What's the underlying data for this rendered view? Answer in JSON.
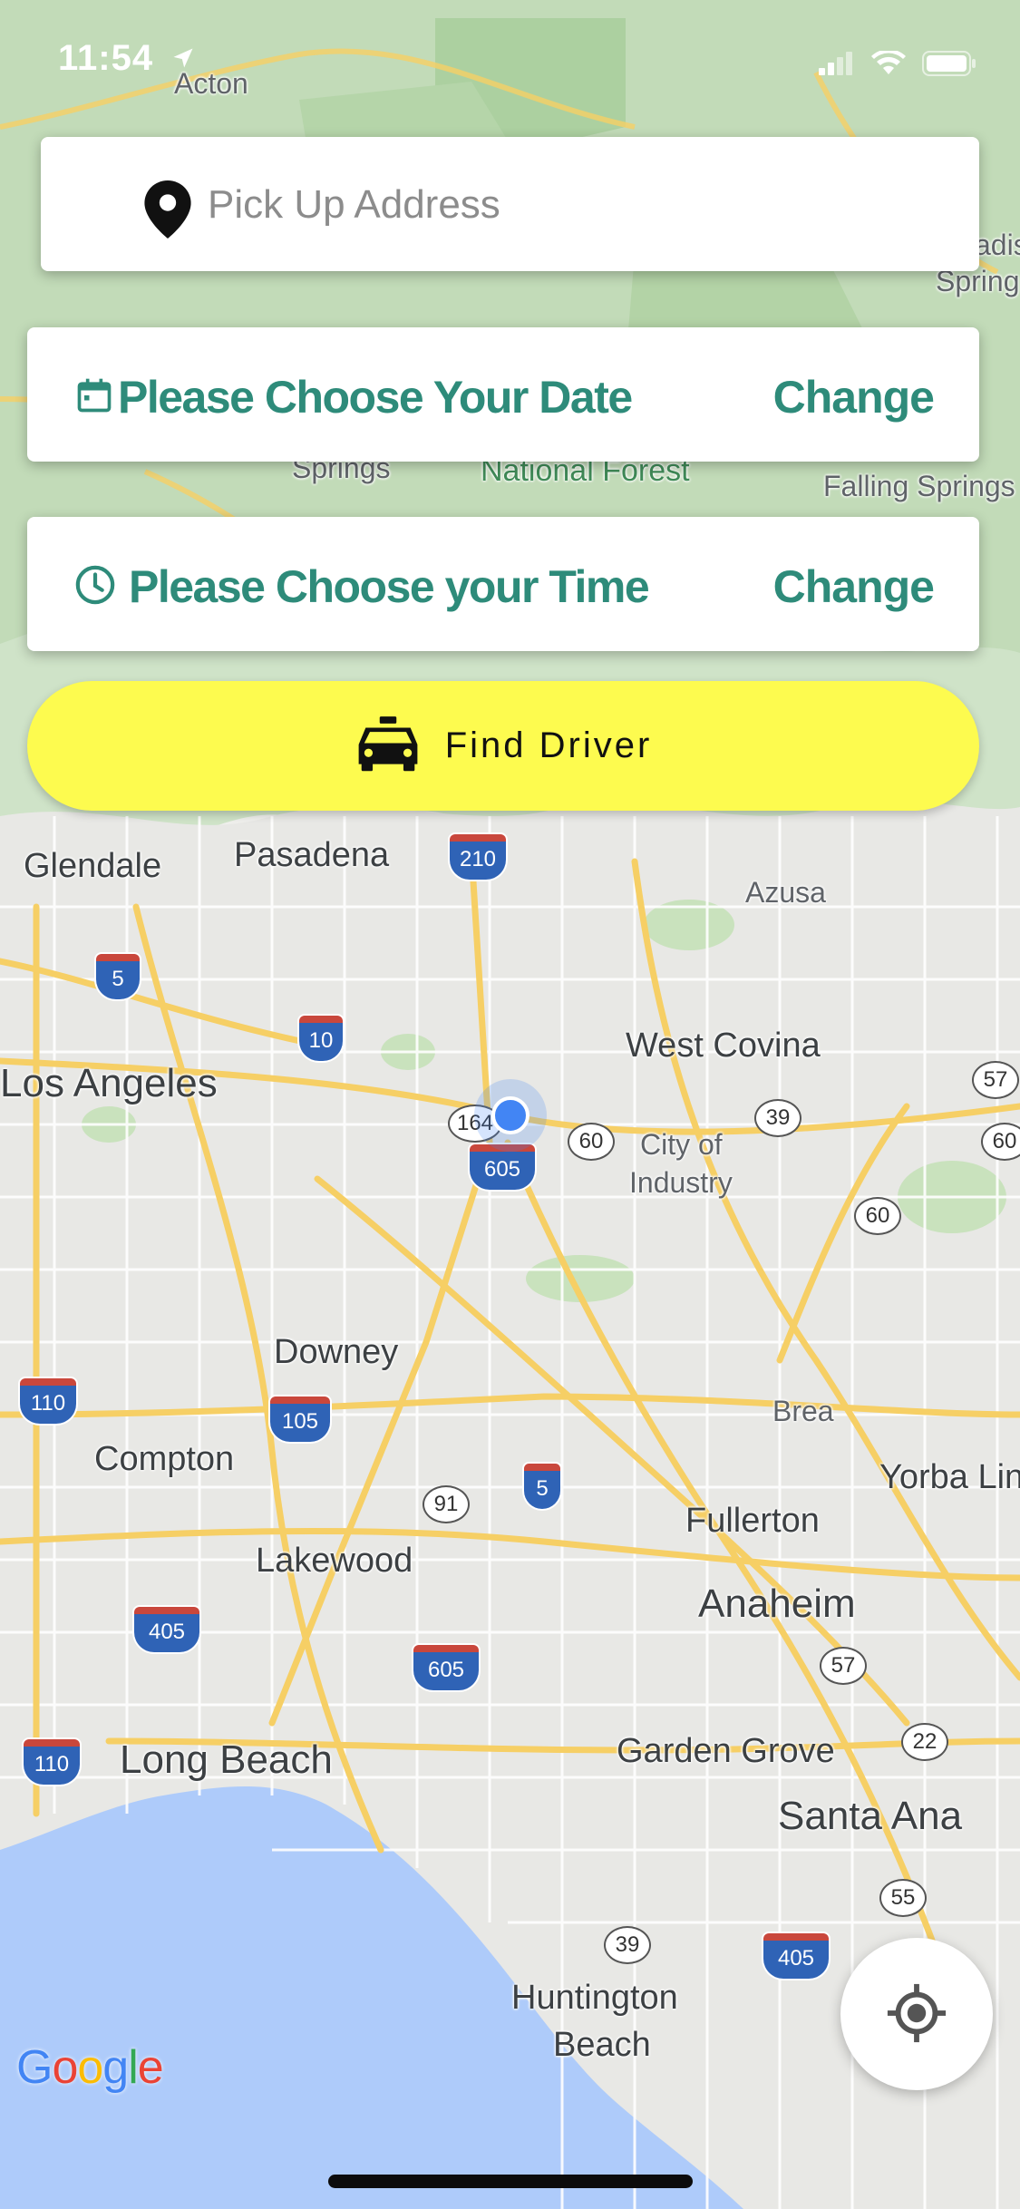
{
  "status_bar": {
    "time": "11:54"
  },
  "pickup": {
    "placeholder": "Pick Up Address",
    "icon": "map-pin-icon"
  },
  "date_row": {
    "label": "Please Choose Your Date",
    "change_label": "Change",
    "icon": "calendar-icon"
  },
  "time_row": {
    "label": "Please Choose your Time",
    "change_label": "Change",
    "icon": "clock-icon"
  },
  "find_driver": {
    "label": "Find Driver",
    "icon": "taxi-icon",
    "color": "#fdfb4f"
  },
  "accent_color": "#2e8b7a",
  "map": {
    "attribution": "Google",
    "places": [
      "Acton",
      "National Forest",
      "Springs",
      "Falling Springs",
      "Glendale",
      "Pasadena",
      "Azusa",
      "Los Angeles",
      "West Covina",
      "City of",
      "Industry",
      "Downey",
      "Brea",
      "Compton",
      "Yorba Lin",
      "Fullerton",
      "Lakewood",
      "Anaheim",
      "Long Beach",
      "Garden Grove",
      "Santa Ana",
      "Huntington",
      "Beach",
      "adis",
      "Spring"
    ],
    "highways": {
      "i210": "210",
      "i5a": "5",
      "i10": "10",
      "r164": "164",
      "i605a": "605",
      "r60a": "60",
      "r39a": "39",
      "r57a": "57",
      "r60b": "60",
      "r60c": "60",
      "i110a": "110",
      "i105": "105",
      "r91": "91",
      "i5b": "5",
      "i405a": "405",
      "i605b": "605",
      "r57b": "57",
      "i110b": "110",
      "r22": "22",
      "r55": "55",
      "r39b": "39",
      "i405b": "405"
    }
  }
}
